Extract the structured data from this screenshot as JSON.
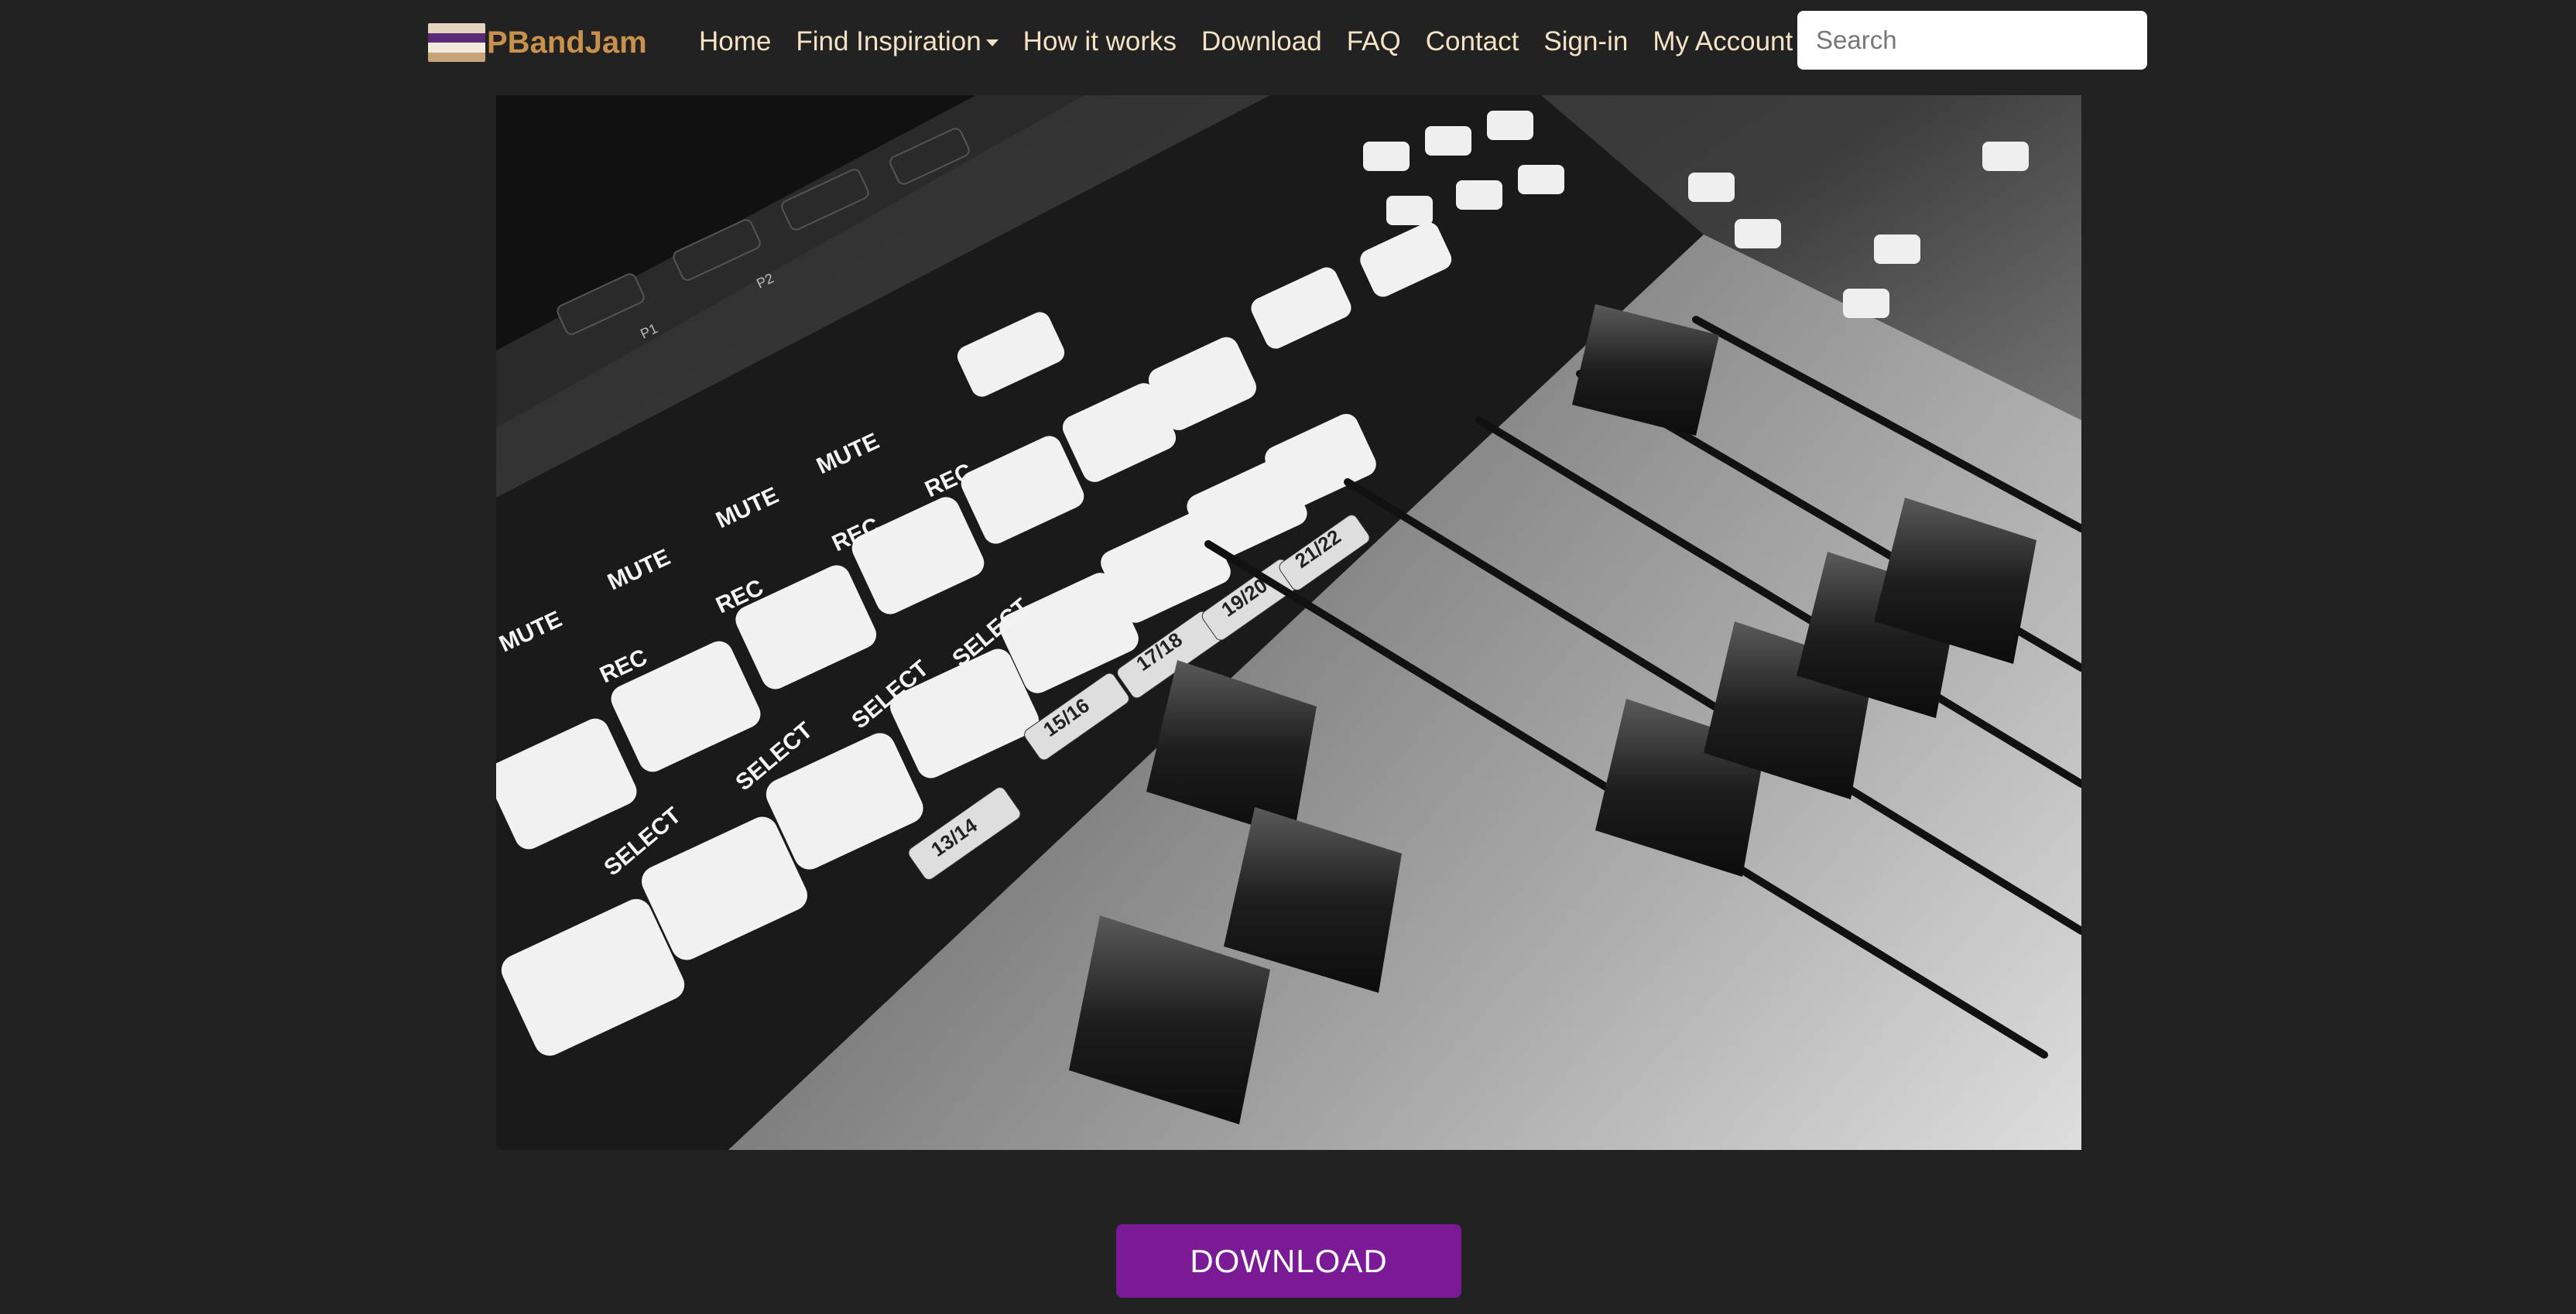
{
  "brand": {
    "name": "PBandJam"
  },
  "nav": {
    "home": "Home",
    "find_inspiration": "Find Inspiration",
    "how_it_works": "How it works",
    "download": "Download",
    "faq": "FAQ",
    "contact": "Contact",
    "sign_in": "Sign-in",
    "my_account": "My Account"
  },
  "search": {
    "placeholder": "Search"
  },
  "hero": {
    "labels": [
      "MUTE",
      "MUTE",
      "MUTE",
      "MUTE",
      "REC",
      "REC",
      "REC",
      "REC",
      "SELECT",
      "SELECT",
      "SELECT",
      "SELECT",
      "15/16",
      "17/18",
      "19/20",
      "21/22",
      "13/14",
      "P1",
      "P2"
    ]
  },
  "cta": {
    "download_label": "DOWNLOAD"
  },
  "colors": {
    "background": "#222222",
    "brand": "#c9914b",
    "nav_text": "#f4e3c4",
    "download_button": "#7a1a96"
  }
}
